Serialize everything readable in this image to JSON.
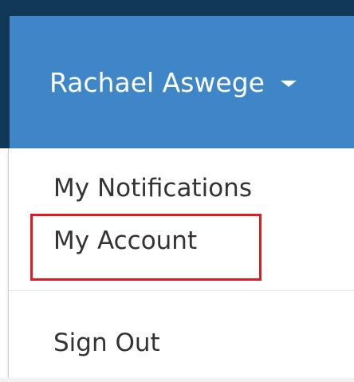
{
  "user_menu": {
    "user_name": "Rachael Aswege",
    "caret_icon": "caret-down-icon",
    "items": [
      {
        "label": "My Notifications"
      },
      {
        "label": "My Account"
      },
      {
        "label": "Sign Out"
      }
    ]
  },
  "colors": {
    "header_blue": "#3f86c8",
    "dark_navy": "#0f3957",
    "highlight_red": "#e01b24"
  }
}
